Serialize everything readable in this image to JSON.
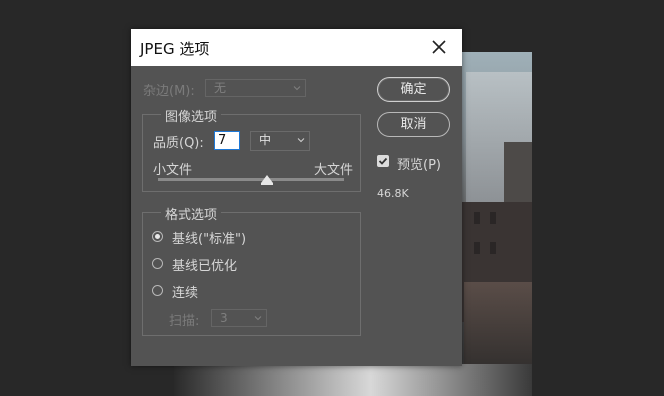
{
  "dialog": {
    "title": "JPEG 选项",
    "matte": {
      "label": "杂边(M):",
      "value": "无"
    },
    "image_options": {
      "legend": "图像选项",
      "quality_label": "品质(Q):",
      "quality_value": "7",
      "quality_preset": "中",
      "small_file": "小文件",
      "large_file": "大文件",
      "quality_level": 7,
      "quality_max": 12
    },
    "format_options": {
      "legend": "格式选项",
      "baseline_standard": "基线(\"标准\")",
      "baseline_optimized": "基线已优化",
      "progressive": "连续",
      "scans_label": "扫描:",
      "scans_value": "3",
      "selected": "baseline_standard"
    },
    "buttons": {
      "ok": "确定",
      "cancel": "取消"
    },
    "preview": {
      "label": "预览(P)",
      "checked": true
    },
    "file_size": "46.8K"
  }
}
